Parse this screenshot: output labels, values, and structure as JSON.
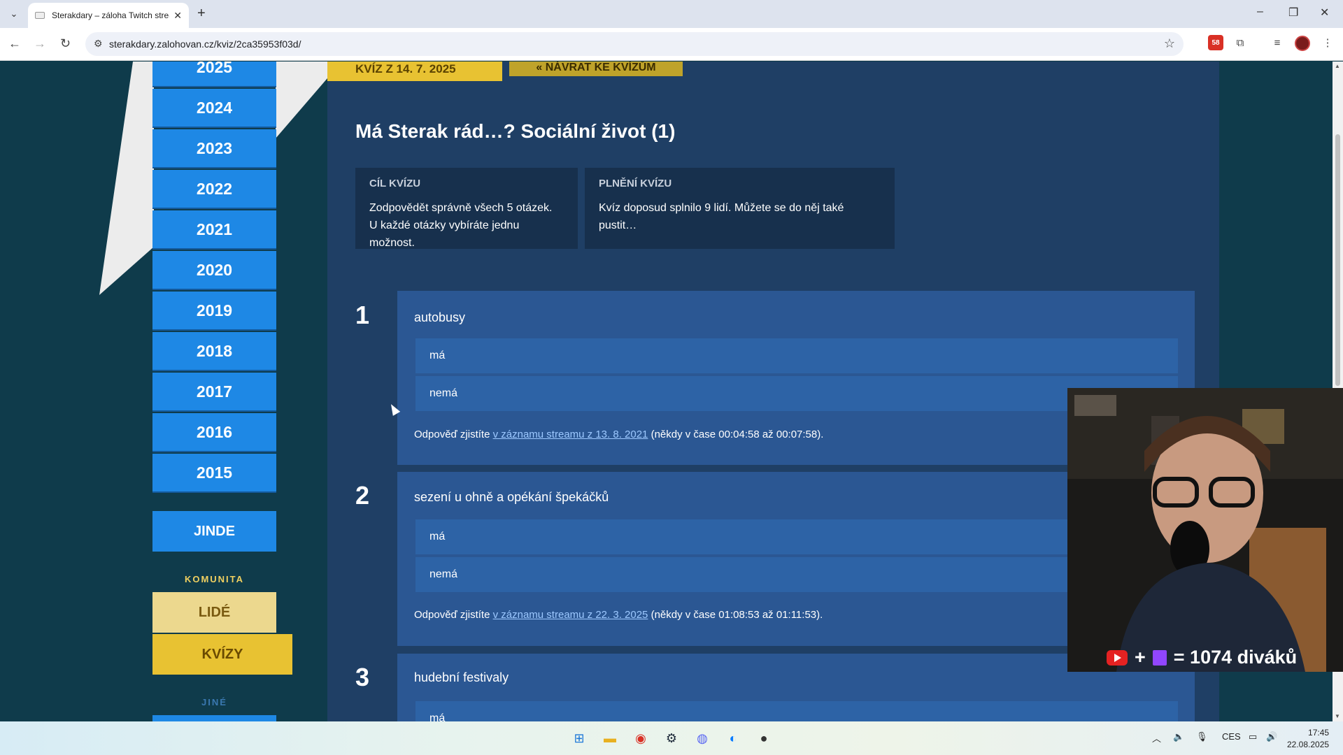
{
  "browser": {
    "tab_title": "Sterakdary – záloha Twitch strea",
    "url": "sterakdary.zalohovan.cz/kviz/2ca35953f03d/",
    "ext_badge": "58"
  },
  "sidebar": {
    "years": [
      "2025",
      "2024",
      "2023",
      "2022",
      "2021",
      "2020",
      "2019",
      "2018",
      "2017",
      "2016",
      "2015"
    ],
    "jinde": "JINDE",
    "komunita": "KOMUNITA",
    "lide": "LIDÉ",
    "kvizy": "KVÍZY",
    "jine": "JINÉ"
  },
  "header": {
    "date_tab": "KVÍZ Z 14. 7. 2025",
    "back_tab": "« NÁVRAT KE KVÍZŮM"
  },
  "quiz": {
    "title": "Má Sterak rád…? Sociální život (1)",
    "goal_heading": "CÍL KVÍZU",
    "goal_line1": "Zodpovědět správně všech 5 otázek.",
    "goal_line2": "U každé otázky vybíráte jednu možnost.",
    "completion_heading": "PLNĚNÍ KVÍZU",
    "completion_text": "Kvíz doposud splnilo 9 lidí. Můžete se do něj také pustit…",
    "questions": [
      {
        "num": "1",
        "text": "autobusy",
        "options": [
          "má",
          "nemá"
        ],
        "ans_pre": "Odpověď zjistíte ",
        "ans_link": "v záznamu streamu z 13. 8. 2021",
        "ans_post": " (někdy v čase 00:04:58 až 00:07:58)."
      },
      {
        "num": "2",
        "text": "sezení u ohně a opékání špekáčků",
        "options": [
          "má",
          "nemá"
        ],
        "ans_pre": "Odpověď zjistíte ",
        "ans_link": "v záznamu streamu z 22. 3. 2025",
        "ans_post": " (někdy v čase 01:08:53 až 01:11:53)."
      },
      {
        "num": "3",
        "text": "hudební festivaly",
        "options": [
          "má"
        ]
      }
    ]
  },
  "overlay": {
    "plus": "+",
    "viewers": "= 1074 diváků"
  },
  "taskbar": {
    "lang": "CES",
    "time": "17:45",
    "date": "22.08.2025"
  }
}
